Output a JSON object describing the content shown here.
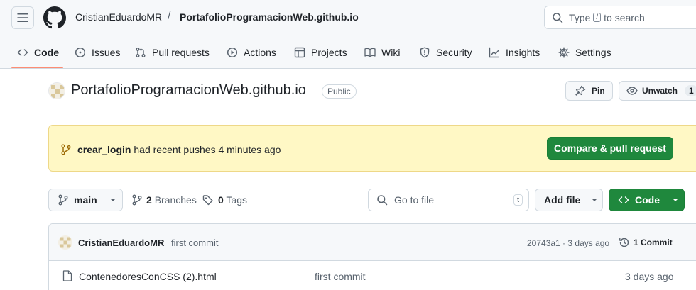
{
  "header": {
    "owner": "CristianEduardoMR",
    "separator": "/",
    "repo": "PortafolioProgramacionWeb.github.io",
    "search": {
      "prefix": "Type",
      "key": "/",
      "suffix": "to search"
    }
  },
  "tabs": [
    {
      "label": "Code",
      "icon": "code-icon",
      "active": true
    },
    {
      "label": "Issues",
      "icon": "issue-icon"
    },
    {
      "label": "Pull requests",
      "icon": "pull-request-icon"
    },
    {
      "label": "Actions",
      "icon": "play-icon"
    },
    {
      "label": "Projects",
      "icon": "table-icon"
    },
    {
      "label": "Wiki",
      "icon": "book-icon"
    },
    {
      "label": "Security",
      "icon": "shield-icon"
    },
    {
      "label": "Insights",
      "icon": "graph-icon"
    },
    {
      "label": "Settings",
      "icon": "gear-icon"
    }
  ],
  "repo": {
    "title": "PortafolioProgramacionWeb.github.io",
    "visibility": "Public",
    "pin_label": "Pin",
    "watch_label": "Unwatch",
    "watch_count": "1"
  },
  "flash": {
    "branch": "crear_login",
    "message": "had recent pushes 4 minutes ago",
    "button": "Compare & pull request"
  },
  "toolbar": {
    "branch": "main",
    "branches_count": "2",
    "branches_label": "Branches",
    "tags_count": "0",
    "tags_label": "Tags",
    "goto_placeholder": "Go to file",
    "goto_key": "t",
    "add_file": "Add file",
    "code": "Code"
  },
  "latest_commit": {
    "author": "CristianEduardoMR",
    "message": "first commit",
    "hash_time": "20743a1 · 3 days ago",
    "commit_count": "1 Commit"
  },
  "files": [
    {
      "name": "ContenedoresConCSS (2).html",
      "message": "first commit",
      "time": "3 days ago"
    }
  ],
  "colors": {
    "accent_underline": "#fd8c73",
    "primary_green": "#1f883d",
    "flash_bg": "#fff8c5",
    "header_bg": "#f6f8fa"
  }
}
